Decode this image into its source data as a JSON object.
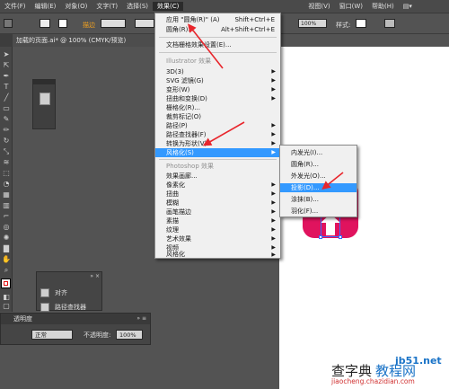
{
  "menubar": {
    "items": [
      "文件(F)",
      "编辑(E)",
      "对象(O)",
      "文字(T)",
      "选择(S)",
      "效果(C)",
      "视图(V)",
      "窗口(W)",
      "帮助(H)"
    ],
    "active_index": 5
  },
  "controlbar": {
    "stroke_label": "描边",
    "opacity_value": "100%",
    "style_label": "样式:"
  },
  "document_tab": {
    "title": "加载的页面.ai* @ 100% (CMYK/预览)"
  },
  "effect_menu": {
    "apply_last": {
      "label": "应用 \"圆角(R)\" (A)",
      "shortcut": "Shift+Ctrl+E"
    },
    "last_effect": {
      "label": "圆角(R)...",
      "shortcut": "Alt+Shift+Ctrl+E"
    },
    "doc_raster": "文档栅格效果设置(E)...",
    "illustrator_section": "Illustrator 效果",
    "illustrator_items": [
      {
        "label": "3D(3)",
        "sub": true
      },
      {
        "label": "SVG 滤镜(G)",
        "sub": true
      },
      {
        "label": "变形(W)",
        "sub": true
      },
      {
        "label": "扭曲和变换(D)",
        "sub": true
      },
      {
        "label": "栅格化(R)...",
        "sub": false
      },
      {
        "label": "裁剪标记(O)",
        "sub": false
      },
      {
        "label": "路径(P)",
        "sub": true
      },
      {
        "label": "路径查找器(F)",
        "sub": true
      },
      {
        "label": "转换为形状(V)",
        "sub": true
      },
      {
        "label": "风格化(S)",
        "sub": true,
        "highlight": true
      }
    ],
    "photoshop_section": "Photoshop 效果",
    "photoshop_items": [
      {
        "label": "效果画廊..."
      },
      {
        "label": "像素化"
      },
      {
        "label": "扭曲"
      },
      {
        "label": "模糊"
      },
      {
        "label": "画笔描边"
      },
      {
        "label": "素描"
      },
      {
        "label": "纹理"
      },
      {
        "label": "艺术效果"
      },
      {
        "label": "视频"
      },
      {
        "label": "风格化"
      }
    ]
  },
  "stylize_submenu": {
    "items": [
      {
        "label": "内发光(I)..."
      },
      {
        "label": "圆角(R)..."
      },
      {
        "label": "外发光(O)..."
      },
      {
        "label": "投影(D)...",
        "highlight": true
      },
      {
        "label": "涂抹(B)..."
      },
      {
        "label": "羽化(F)..."
      }
    ]
  },
  "panels": {
    "align": "对齐",
    "pathfinder": "路径查找器",
    "transparency": {
      "title": "透明度",
      "mode": "正常",
      "opacity_label": "不透明度:",
      "opacity_value": "100%"
    }
  },
  "watermark": {
    "site": "jb51.net",
    "brand_a": "查字典",
    "brand_b": "教程网",
    "url": "jiaocheng.chazidian.com"
  },
  "colors": {
    "art_fill": "#e0135e",
    "menu_highlight": "#3399ff",
    "annotation_arrow": "#e8262c"
  }
}
